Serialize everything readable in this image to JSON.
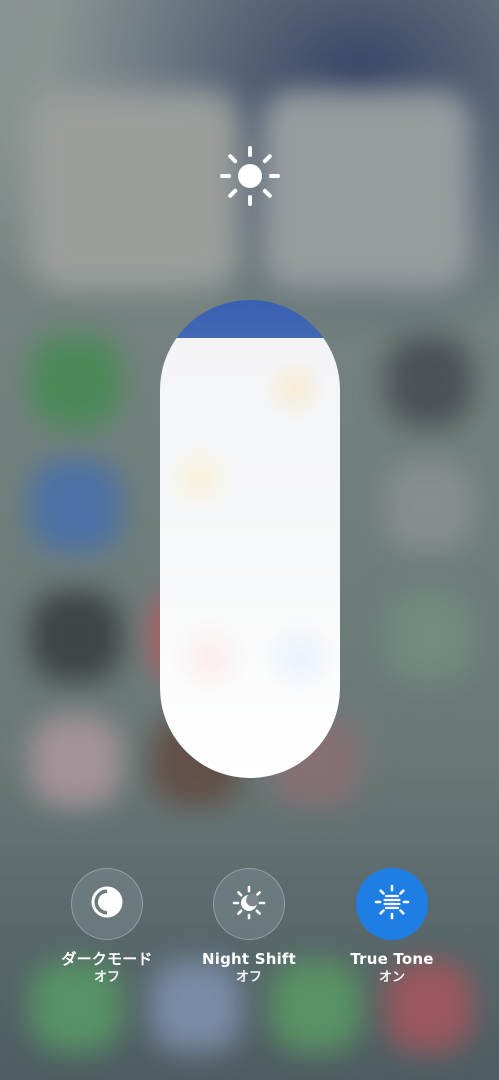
{
  "brightness": {
    "level": 0.92,
    "icon": "sun-icon"
  },
  "toggles": [
    {
      "name": "dark-mode",
      "label": "ダークモード",
      "state": "オフ",
      "on": false,
      "icon": "dark-mode-icon"
    },
    {
      "name": "night-shift",
      "label": "Night Shift",
      "state": "オフ",
      "on": false,
      "icon": "night-shift-icon"
    },
    {
      "name": "true-tone",
      "label": "True Tone",
      "state": "オン",
      "on": true,
      "icon": "true-tone-icon"
    }
  ],
  "colors": {
    "active": "#1f7de6",
    "inactive": "#7b878c",
    "slider_fill": "#f7f8f9",
    "slider_empty": "#2c4f9c"
  }
}
